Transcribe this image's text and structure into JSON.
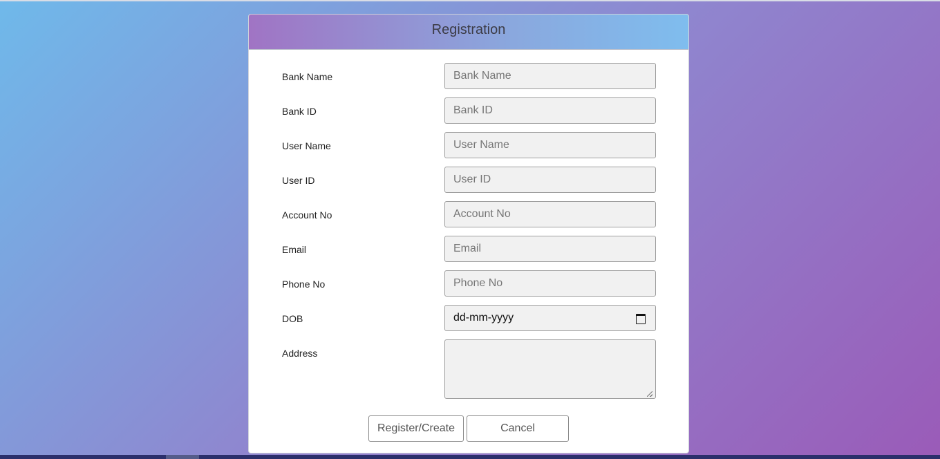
{
  "form": {
    "title": "Registration",
    "fields": [
      {
        "label": "Bank Name",
        "placeholder": "Bank Name",
        "value": ""
      },
      {
        "label": "Bank ID",
        "placeholder": "Bank ID",
        "value": ""
      },
      {
        "label": "User Name",
        "placeholder": "User Name",
        "value": ""
      },
      {
        "label": "User ID",
        "placeholder": "User ID",
        "value": ""
      },
      {
        "label": "Account No",
        "placeholder": "Account No",
        "value": ""
      },
      {
        "label": "Email",
        "placeholder": "Email",
        "value": ""
      },
      {
        "label": "Phone No",
        "placeholder": "Phone No",
        "value": ""
      }
    ],
    "dob": {
      "label": "DOB",
      "value": "dd-mm-yyyy",
      "icon": "calendar-icon"
    },
    "address": {
      "label": "Address",
      "value": ""
    },
    "buttons": {
      "register": "Register/Create",
      "cancel": "Cancel"
    }
  },
  "colors": {
    "gradient_start": "#6fb9ea",
    "gradient_end": "#9a5bb8",
    "header_left": "#a074c4",
    "header_right": "#7fbdee",
    "field_bg": "#f1f1f1"
  }
}
